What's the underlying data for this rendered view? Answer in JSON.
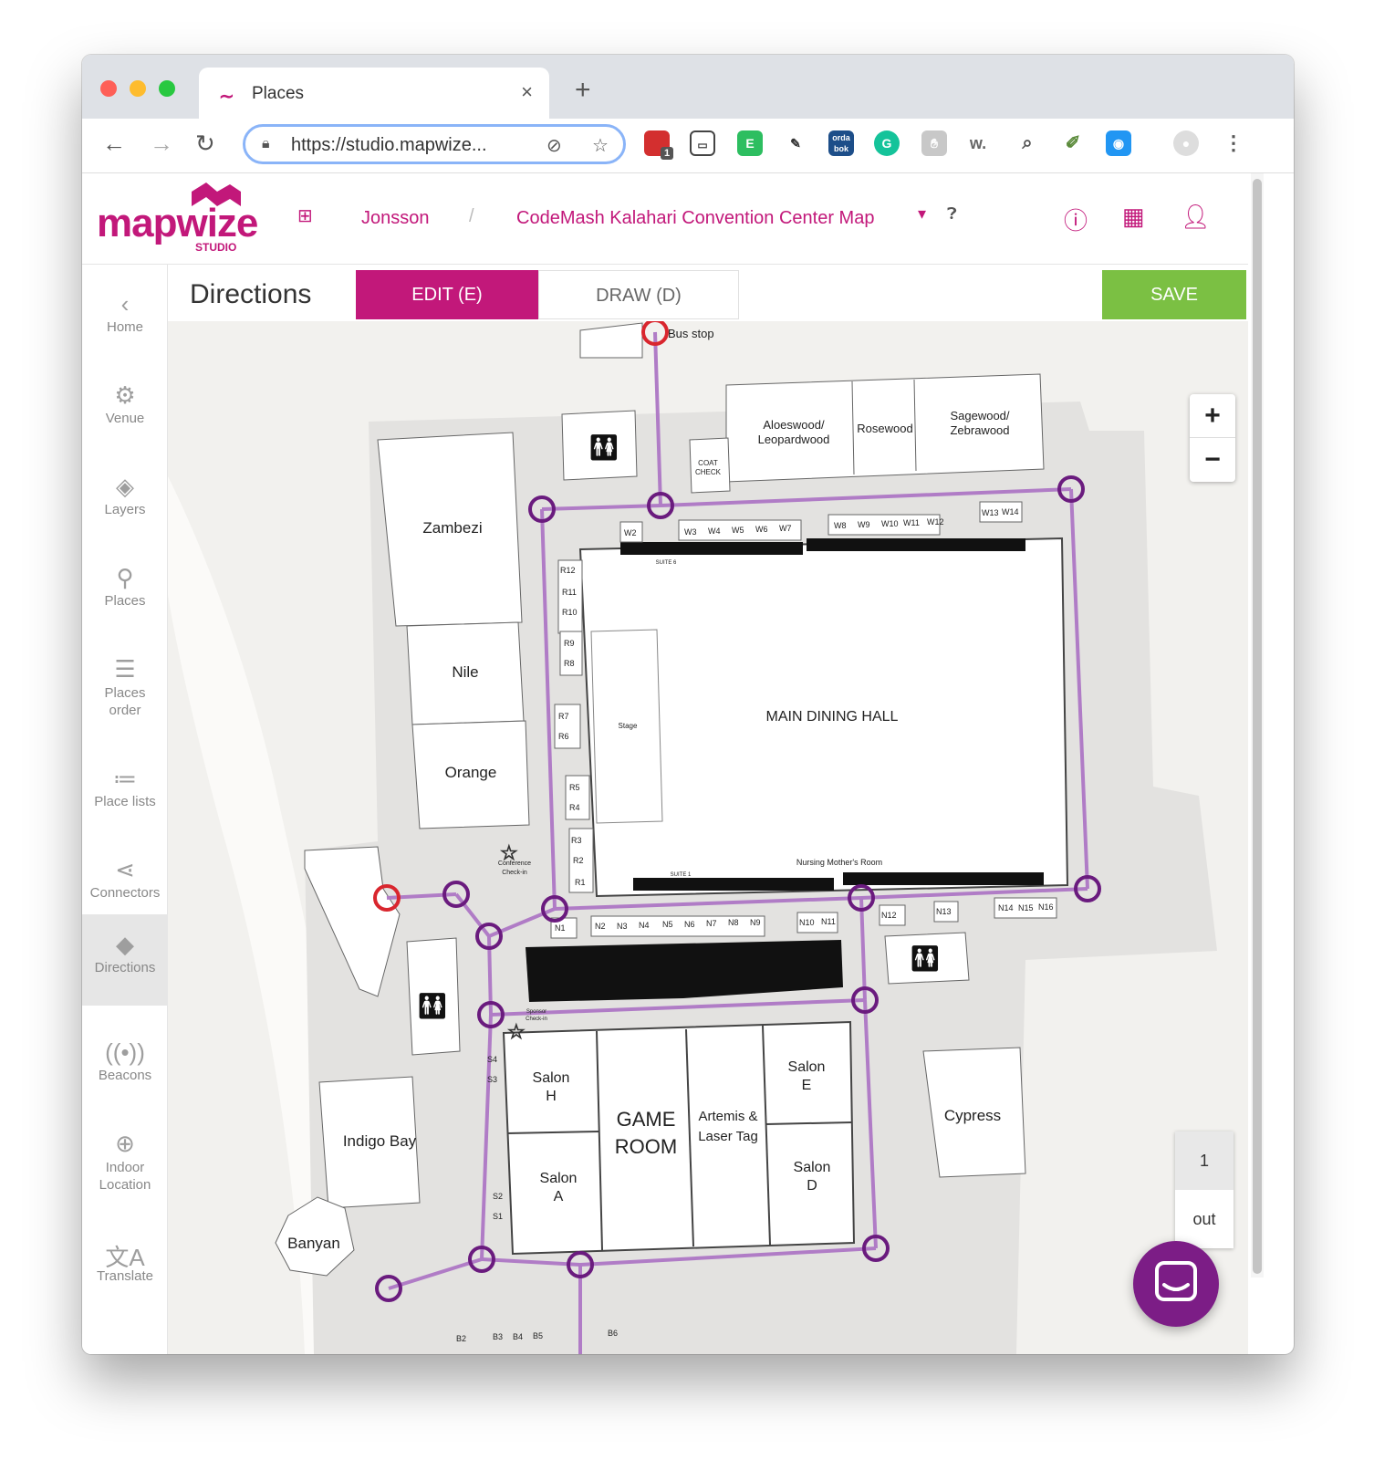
{
  "browser": {
    "tab_title": "Places",
    "url": "https://studio.mapwize...",
    "new_tab": "+",
    "tab_close": "×"
  },
  "extensions": [
    "1",
    "orda bok",
    "w."
  ],
  "header": {
    "logo": "mapwize",
    "logo_sub": "STUDIO",
    "organization": "Jonsson",
    "separator": "/",
    "venue": "CodeMash Kalahari Convention Center Map"
  },
  "sidebar": {
    "items": [
      {
        "label": "Home",
        "icon": "chevron-left-icon"
      },
      {
        "label": "Venue",
        "icon": "gear-icon"
      },
      {
        "label": "Layers",
        "icon": "layers-icon"
      },
      {
        "label": "Places",
        "icon": "location-pin-icon"
      },
      {
        "label": "Places order",
        "icon": "sort-icon"
      },
      {
        "label": "Place lists",
        "icon": "list-icon"
      },
      {
        "label": "Connectors",
        "icon": "share-icon"
      },
      {
        "label": "Directions",
        "icon": "directions-icon"
      },
      {
        "label": "Beacons",
        "icon": "beacon-icon"
      },
      {
        "label": "Indoor Location",
        "icon": "target-icon"
      },
      {
        "label": "Translate",
        "icon": "translate-icon"
      }
    ],
    "active": "Directions"
  },
  "page": {
    "title": "Directions",
    "edit_label": "EDIT (E)",
    "draw_label": "DRAW (D)",
    "save_label": "SAVE"
  },
  "map": {
    "zoom_in": "+",
    "zoom_out": "−",
    "floor": "1",
    "floor_out": "out",
    "rooms": {
      "bus_stop": "Bus stop",
      "aloeswood_1": "Aloeswood/",
      "aloeswood_2": "Leopardwood",
      "rosewood": "Rosewood",
      "sagewood_1": "Sagewood/",
      "sagewood_2": "Zebrawood",
      "coat_1": "COAT",
      "coat_2": "CHECK",
      "zambezi": "Zambezi",
      "nile": "Nile",
      "orange": "Orange",
      "main_dining": "MAIN DINING HALL",
      "stage": "Stage",
      "nursing": "Nursing Mother's Room",
      "suite6": "SUITE 6",
      "suite1": "SUITE 1",
      "conference_1": "Conference",
      "conference_2": "Check-in",
      "sponsor_1": "Sponsor",
      "sponsor_2": "Check-in",
      "salon_h_1": "Salon",
      "salon_h_2": "H",
      "salon_a_1": "Salon",
      "salon_a_2": "A",
      "game_1": "GAME",
      "game_2": "ROOM",
      "artemis_1": "Artemis &",
      "artemis_2": "Laser Tag",
      "salon_e_1": "Salon",
      "salon_e_2": "E",
      "salon_d_1": "Salon",
      "salon_d_2": "D",
      "cypress": "Cypress",
      "indigo": "Indigo Bay",
      "banyan": "Banyan"
    },
    "booths_w": [
      "W2",
      "W3",
      "W4",
      "W5",
      "W6",
      "W7",
      "W8",
      "W9",
      "W10",
      "W11",
      "W12",
      "W13",
      "W14"
    ],
    "booths_r": [
      "R12",
      "R11",
      "R10",
      "R9",
      "R8",
      "R7",
      "R6",
      "R5",
      "R4",
      "R3",
      "R2",
      "R1"
    ],
    "booths_n": [
      "N1",
      "N2",
      "N3",
      "N4",
      "N5",
      "N6",
      "N7",
      "N8",
      "N9",
      "N10",
      "N11",
      "N12",
      "N13",
      "N14",
      "N15",
      "N16"
    ],
    "booths_s": [
      "S4",
      "S3",
      "S2",
      "S1"
    ],
    "booths_b": [
      "B2",
      "B3",
      "B4",
      "B5",
      "B6"
    ]
  },
  "colors": {
    "brand": "#c2187a",
    "save": "#7bc043",
    "graph_node": "#6a1b7e",
    "graph_edge": "#b07cc6",
    "endpoint": "#d9262e",
    "chat": "#7c1d86"
  }
}
